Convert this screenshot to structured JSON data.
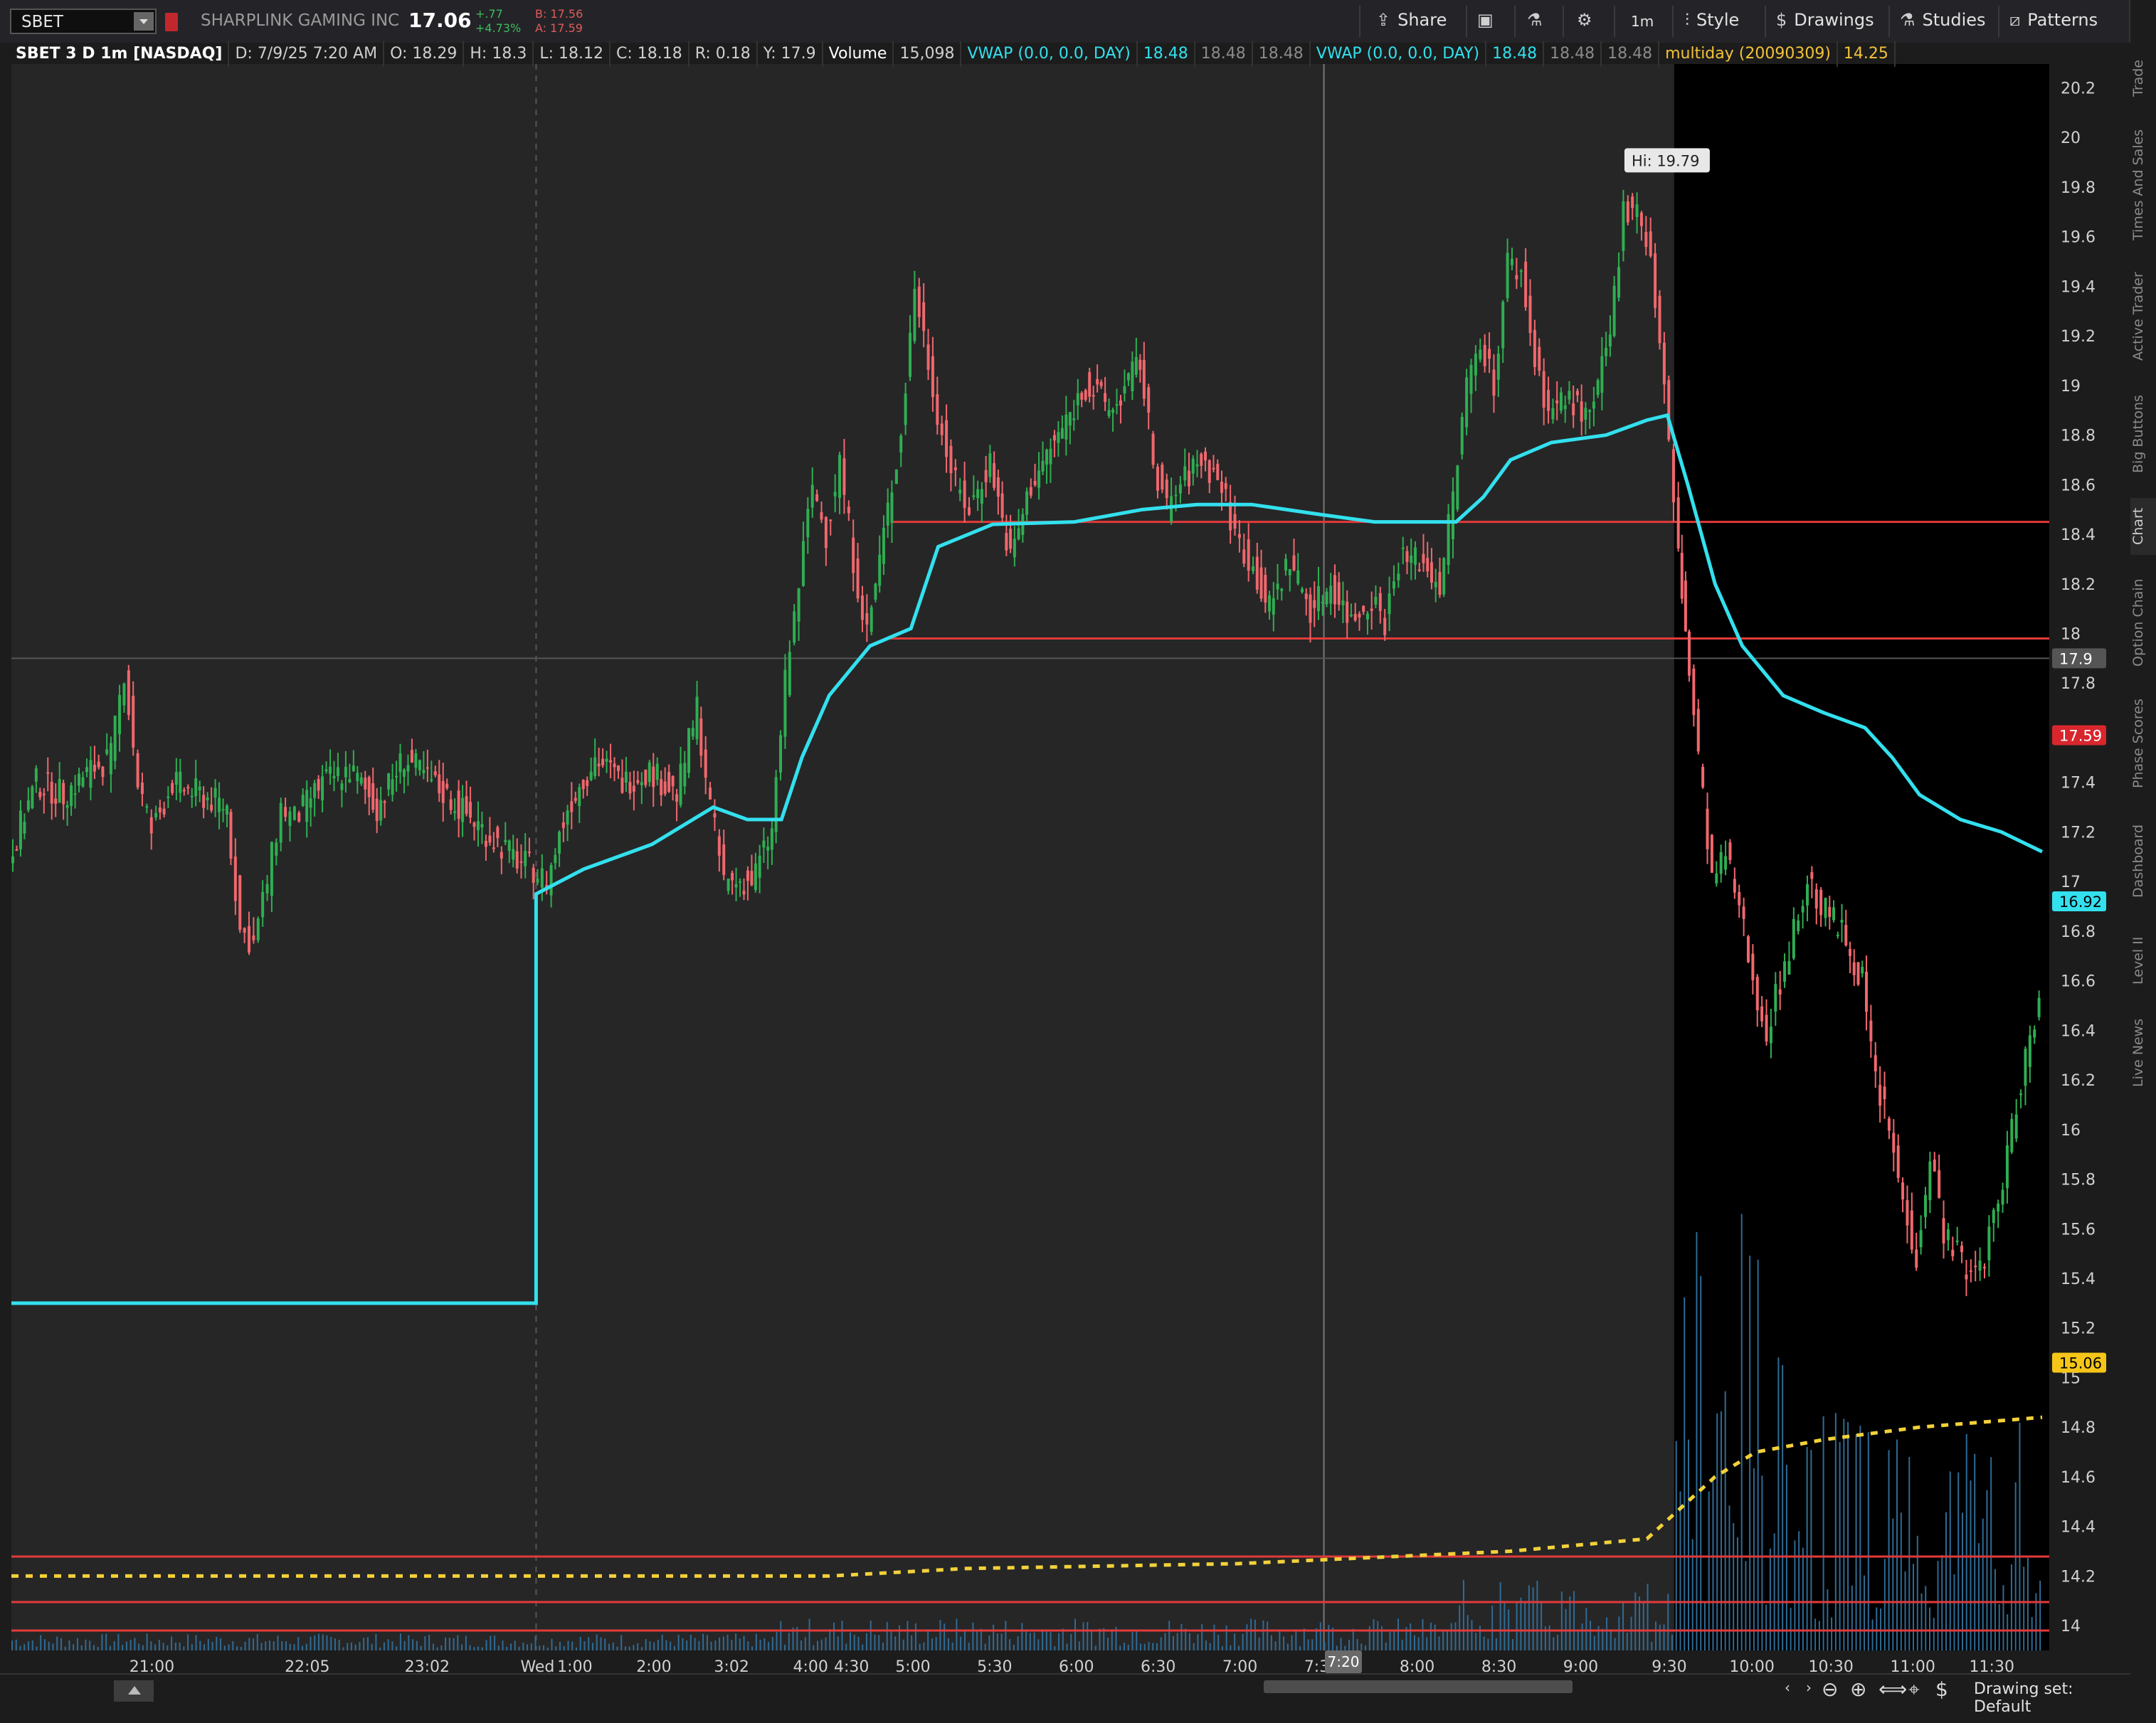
{
  "toolbar": {
    "symbol": "SBET",
    "company": "SHARPLINK GAMING INC",
    "last": "17.06",
    "change": "+.77",
    "change_pct": "+4.73%",
    "bid": "B: 17.56",
    "ask": "A: 17.59",
    "buttons": {
      "share": "Share",
      "timeframe": "1m",
      "style": "Style",
      "drawings": "Drawings",
      "studies": "Studies",
      "patterns": "Patterns"
    }
  },
  "side_tabs": [
    "Trade",
    "Times And Sales",
    "Active Trader",
    "Big Buttons",
    "Chart",
    "Option Chain",
    "Phase Scores",
    "Dashboard",
    "Level II",
    "Live News"
  ],
  "infobar": {
    "title": "SBET 3 D 1m [NASDAQ]",
    "date": "D: 7/9/25 7:20 AM",
    "open": "O: 18.29",
    "high": "H: 18.3",
    "low": "L: 18.12",
    "close": "C: 18.18",
    "range": "R: 0.18",
    "y": "Y: 17.9",
    "volume_label": "Volume",
    "volume_value": "15,098",
    "vwap1_label": "VWAP (0.0, 0.0, DAY)",
    "vwap1_v1": "18.48",
    "vwap1_v2": "18.48",
    "vwap1_v3": "18.48",
    "vwap2_label": "VWAP (0.0, 0.0, DAY)",
    "vwap2_v1": "18.48",
    "vwap2_v2": "18.48",
    "vwap2_v3": "18.48",
    "multiday_label": "multiday (20090309)",
    "multiday_value": "14.25"
  },
  "colors": {
    "up": "#2fae52",
    "down": "#f0676d",
    "vwap": "#33e0ee",
    "multiday": "#f2d13a",
    "level": "#e23a3a",
    "volume": "#2f6b95"
  },
  "chart_data": {
    "type": "candlestick",
    "symbol": "SBET",
    "interval": "1m",
    "ylim": [
      13.9,
      20.25
    ],
    "y_ticks": [
      "20.2",
      "20",
      "19.8",
      "19.6",
      "19.4",
      "19.2",
      "19",
      "18.8",
      "18.6",
      "18.4",
      "18.2",
      "18",
      "17.8",
      "17.6",
      "17.4",
      "17.2",
      "17",
      "16.8",
      "16.6",
      "16.4",
      "16.2",
      "16",
      "15.8",
      "15.6",
      "15.4",
      "15.2",
      "15",
      "14.8",
      "14.6",
      "14.4",
      "14.2",
      "14"
    ],
    "x_ticks": [
      "21:00",
      "22:05",
      "23:02",
      "Wed",
      "1:00",
      "2:00",
      "3:02",
      "4:00",
      "4:30",
      "5:00",
      "5:30",
      "6:00",
      "6:30",
      "7:00",
      "7:30",
      "8:00",
      "8:30",
      "9:00",
      "9:30",
      "10:00",
      "10:30",
      "11:00",
      "11:30"
    ],
    "cursor_time": "7:20",
    "high_marker": "Hi: 19.79",
    "price_labels": {
      "crosshair": "17.9",
      "ask": "17.59",
      "vwap": "16.92",
      "multiday": "15.06"
    },
    "horizontal_levels": [
      18.45,
      17.98
    ],
    "volume_levels_note": "",
    "price_path": [
      [
        0,
        17.1
      ],
      [
        20,
        17.4
      ],
      [
        40,
        17.35
      ],
      [
        60,
        17.45
      ],
      [
        75,
        17.5
      ],
      [
        85,
        17.85
      ],
      [
        95,
        17.4
      ],
      [
        105,
        17.2
      ],
      [
        120,
        17.4
      ],
      [
        140,
        17.35
      ],
      [
        160,
        17.3
      ],
      [
        170,
        16.8
      ],
      [
        180,
        16.75
      ],
      [
        190,
        17.0
      ],
      [
        200,
        17.3
      ],
      [
        210,
        17.25
      ],
      [
        230,
        17.4
      ],
      [
        250,
        17.45
      ],
      [
        270,
        17.3
      ],
      [
        290,
        17.5
      ],
      [
        310,
        17.4
      ],
      [
        330,
        17.3
      ],
      [
        350,
        17.2
      ],
      [
        370,
        17.1
      ],
      [
        385,
        17.05
      ],
      [
        395,
        17.0
      ],
      [
        410,
        17.3
      ],
      [
        430,
        17.5
      ],
      [
        450,
        17.4
      ],
      [
        470,
        17.45
      ],
      [
        490,
        17.35
      ],
      [
        505,
        17.7
      ],
      [
        515,
        17.3
      ],
      [
        525,
        17.0
      ],
      [
        545,
        17.0
      ],
      [
        560,
        17.2
      ],
      [
        570,
        17.8
      ],
      [
        580,
        18.2
      ],
      [
        590,
        18.6
      ],
      [
        600,
        18.4
      ],
      [
        610,
        18.7
      ],
      [
        620,
        18.3
      ],
      [
        630,
        18.0
      ],
      [
        645,
        18.5
      ],
      [
        655,
        18.8
      ],
      [
        665,
        19.4
      ],
      [
        675,
        19.1
      ],
      [
        685,
        18.8
      ],
      [
        695,
        18.6
      ],
      [
        705,
        18.5
      ],
      [
        720,
        18.7
      ],
      [
        735,
        18.3
      ],
      [
        750,
        18.6
      ],
      [
        770,
        18.8
      ],
      [
        790,
        19.0
      ],
      [
        810,
        18.9
      ],
      [
        830,
        19.1
      ],
      [
        840,
        18.7
      ],
      [
        850,
        18.5
      ],
      [
        860,
        18.6
      ],
      [
        875,
        18.7
      ],
      [
        890,
        18.6
      ],
      [
        900,
        18.4
      ],
      [
        910,
        18.3
      ],
      [
        925,
        18.1
      ],
      [
        940,
        18.3
      ],
      [
        955,
        18.1
      ],
      [
        970,
        18.2
      ],
      [
        985,
        18.05
      ],
      [
        1000,
        18.15
      ],
      [
        1010,
        18.05
      ],
      [
        1020,
        18.3
      ],
      [
        1035,
        18.3
      ],
      [
        1050,
        18.2
      ],
      [
        1060,
        18.55
      ],
      [
        1070,
        19.0
      ],
      [
        1080,
        19.2
      ],
      [
        1090,
        19.0
      ],
      [
        1100,
        19.5
      ],
      [
        1110,
        19.45
      ],
      [
        1120,
        19.1
      ],
      [
        1130,
        18.9
      ],
      [
        1145,
        18.95
      ],
      [
        1160,
        18.85
      ],
      [
        1175,
        19.2
      ],
      [
        1185,
        19.7
      ],
      [
        1195,
        19.75
      ],
      [
        1205,
        19.5
      ],
      [
        1215,
        19.0
      ],
      [
        1222,
        18.5
      ],
      [
        1230,
        18.0
      ],
      [
        1240,
        17.5
      ],
      [
        1250,
        17.0
      ],
      [
        1260,
        17.1
      ],
      [
        1270,
        16.9
      ],
      [
        1280,
        16.6
      ],
      [
        1290,
        16.4
      ],
      [
        1300,
        16.6
      ],
      [
        1310,
        16.8
      ],
      [
        1320,
        17.0
      ],
      [
        1330,
        16.9
      ],
      [
        1345,
        16.8
      ],
      [
        1360,
        16.6
      ],
      [
        1370,
        16.2
      ],
      [
        1380,
        16.0
      ],
      [
        1390,
        15.7
      ],
      [
        1400,
        15.5
      ],
      [
        1410,
        15.9
      ],
      [
        1420,
        15.6
      ],
      [
        1430,
        15.5
      ],
      [
        1440,
        15.4
      ],
      [
        1450,
        15.5
      ],
      [
        1460,
        15.7
      ],
      [
        1470,
        16.0
      ],
      [
        1480,
        16.3
      ],
      [
        1490,
        16.5
      ]
    ],
    "vwap_path": [
      [
        0,
        15.3
      ],
      [
        385,
        15.3
      ],
      [
        385,
        16.95
      ],
      [
        420,
        17.05
      ],
      [
        470,
        17.15
      ],
      [
        515,
        17.3
      ],
      [
        540,
        17.25
      ],
      [
        565,
        17.25
      ],
      [
        580,
        17.5
      ],
      [
        600,
        17.75
      ],
      [
        630,
        17.95
      ],
      [
        660,
        18.02
      ],
      [
        680,
        18.35
      ],
      [
        720,
        18.44
      ],
      [
        780,
        18.45
      ],
      [
        830,
        18.5
      ],
      [
        870,
        18.52
      ],
      [
        910,
        18.52
      ],
      [
        960,
        18.48
      ],
      [
        1000,
        18.45
      ],
      [
        1060,
        18.45
      ],
      [
        1080,
        18.55
      ],
      [
        1100,
        18.7
      ],
      [
        1130,
        18.77
      ],
      [
        1170,
        18.8
      ],
      [
        1200,
        18.86
      ],
      [
        1215,
        18.88
      ],
      [
        1230,
        18.6
      ],
      [
        1250,
        18.2
      ],
      [
        1270,
        17.95
      ],
      [
        1300,
        17.75
      ],
      [
        1330,
        17.68
      ],
      [
        1360,
        17.62
      ],
      [
        1380,
        17.5
      ],
      [
        1400,
        17.35
      ],
      [
        1430,
        17.25
      ],
      [
        1460,
        17.2
      ],
      [
        1490,
        17.12
      ]
    ],
    "multiday_path": [
      [
        0,
        14.2
      ],
      [
        300,
        14.2
      ],
      [
        600,
        14.2
      ],
      [
        700,
        14.23
      ],
      [
        900,
        14.25
      ],
      [
        1100,
        14.3
      ],
      [
        1200,
        14.35
      ],
      [
        1220,
        14.45
      ],
      [
        1250,
        14.6
      ],
      [
        1280,
        14.7
      ],
      [
        1330,
        14.75
      ],
      [
        1400,
        14.8
      ],
      [
        1490,
        14.84
      ]
    ]
  },
  "bottom": {
    "drawing_set": "Drawing set: Default"
  }
}
